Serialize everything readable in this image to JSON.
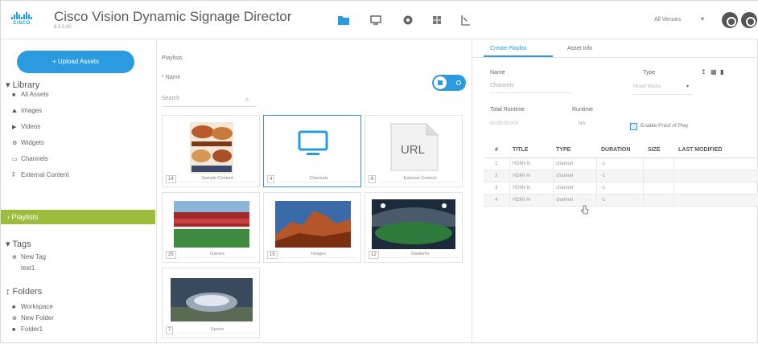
{
  "header": {
    "logo_text": "CISCO",
    "title": "Cisco Vision Dynamic Signage Director",
    "version": "6.1.0.00",
    "nav_icons": [
      "folder-icon",
      "monitor-icon",
      "gear-icon",
      "grid-icon",
      "flow-icon"
    ],
    "venue_select": "All Venues",
    "venue_chevron": "▾"
  },
  "sidebar": {
    "upload_button": "+ Upload Assets",
    "library_heading": "▾ Library",
    "library_items": [
      {
        "icon": "■",
        "label": "All Assets"
      },
      {
        "icon": "⛰",
        "label": "Images"
      },
      {
        "icon": "▶",
        "label": "Videos"
      },
      {
        "icon": "⚙",
        "label": "Widgets"
      },
      {
        "icon": "▭",
        "label": "Channels"
      },
      {
        "icon": "⁑",
        "label": "External Content"
      }
    ],
    "playlists_label": "› Playlists",
    "tags_heading": "▾ Tags",
    "tags_items": [
      {
        "icon": "⊕",
        "label": "New Tag"
      },
      {
        "icon": "",
        "label": "test1"
      }
    ],
    "folders_heading": "↕ Folders",
    "folders_items": [
      {
        "icon": "■",
        "label": "Workspace"
      },
      {
        "icon": "⊕",
        "label": "New Folder"
      },
      {
        "icon": "■",
        "label": "Folder1"
      }
    ]
  },
  "middle": {
    "title": "Playlists",
    "name_label": "* Name",
    "search_placeholder": "Search",
    "search_icon": "⌕",
    "tiles": [
      {
        "count": "14",
        "caption": "Sample Content"
      },
      {
        "count": "4",
        "caption": "Channels"
      },
      {
        "count": "6",
        "caption": "External Content"
      },
      {
        "count": "25",
        "caption": "Games"
      },
      {
        "count": "15",
        "caption": "Images"
      },
      {
        "count": "12",
        "caption": "Stadiums"
      },
      {
        "count": "7",
        "caption": "Sports"
      }
    ],
    "url_label": "URL"
  },
  "right": {
    "tabs": [
      "Create Playlist",
      "Asset Info"
    ],
    "name_label": "Name",
    "name_value": "Channels",
    "type_label": "Type",
    "type_value": "Mixed Media",
    "type_chevron": "▾",
    "toolbar_icons": [
      "↥",
      "▦",
      "▮"
    ],
    "total_runtime_label": "Total Runtime",
    "total_runtime_value": "00:00:00.000",
    "runtime_label": "Runtime",
    "runtime_value": "NA",
    "pop_label": "Enable Proof of Play",
    "table": {
      "headers": [
        "#",
        "TITLE",
        "TYPE",
        "DURATION",
        "SIZE",
        "LAST MODIFIED"
      ],
      "rows": [
        [
          "1",
          "HDMI-In",
          "channel",
          "-1",
          "",
          ""
        ],
        [
          "2",
          "HDMI-In",
          "channel",
          "-1",
          "",
          ""
        ],
        [
          "3",
          "HDMI-In",
          "channel",
          "-1",
          "",
          ""
        ],
        [
          "4",
          "HDMI-In",
          "channel",
          "-1",
          "",
          ""
        ]
      ]
    }
  },
  "colors": {
    "accent": "#2b9be0",
    "playlists_bar": "#9cbd3b",
    "logo": "#1ba0d7"
  }
}
